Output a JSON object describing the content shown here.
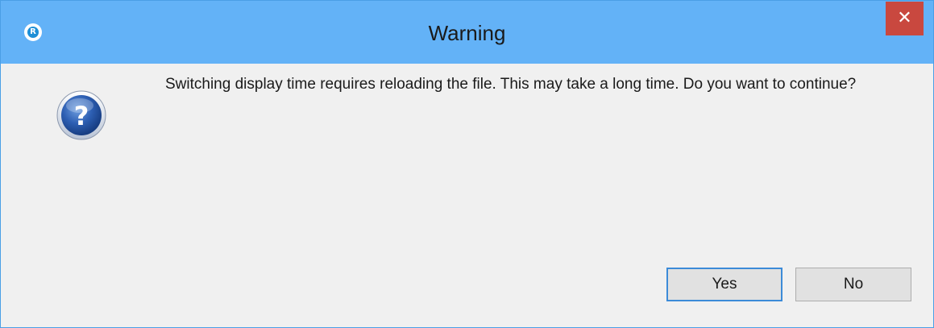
{
  "window": {
    "title": "Warning",
    "close_glyph": "✕",
    "app_icon_letter": "R"
  },
  "dialog": {
    "icon": "question-icon",
    "message": "Switching display time requires reloading the file. This may take a long time. Do you want to continue?",
    "buttons": {
      "yes_label": "Yes",
      "no_label": "No"
    }
  },
  "colors": {
    "titlebar": "#63b2f7",
    "close_button": "#c9483f",
    "body": "#f0f0f0",
    "icon_blue": "#1f4e9c"
  }
}
